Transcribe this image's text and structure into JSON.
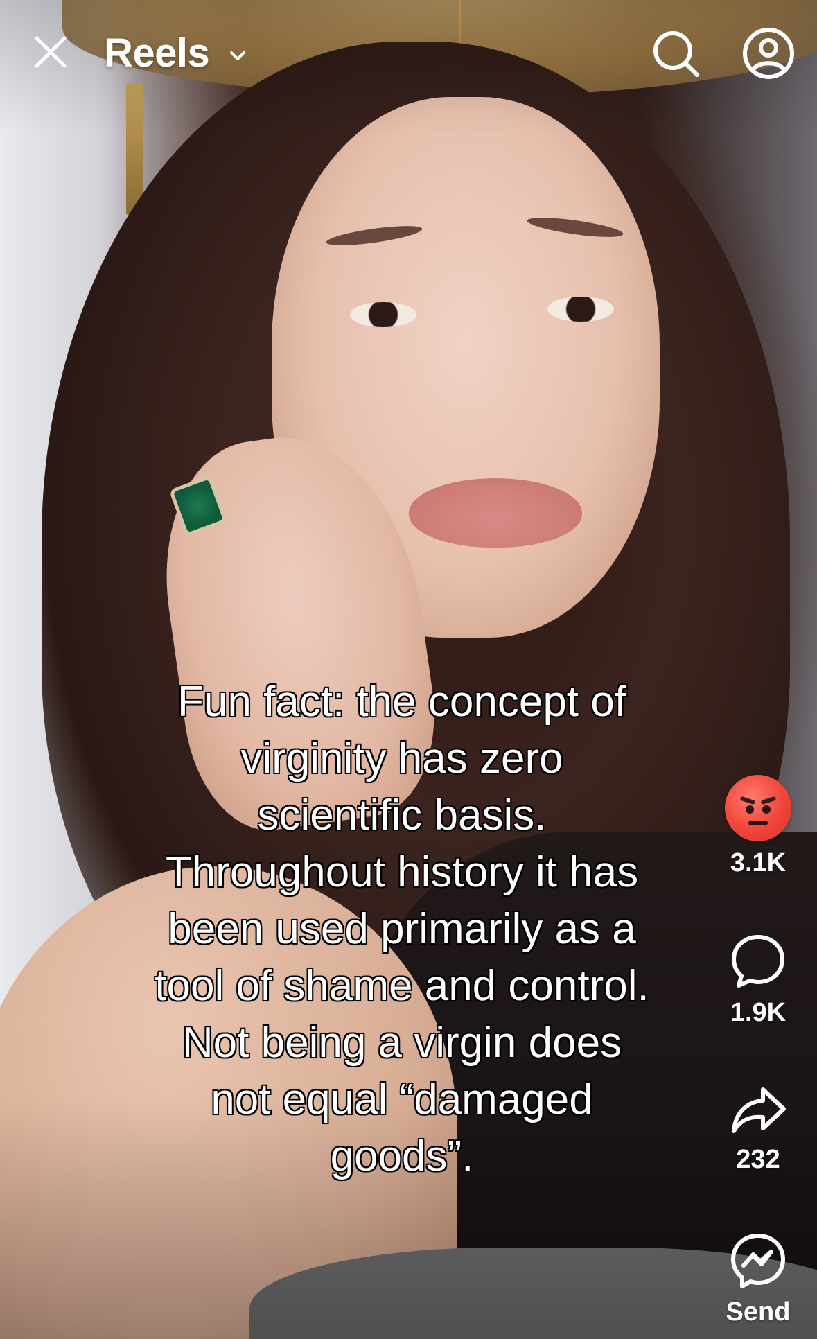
{
  "header": {
    "title": "Reels"
  },
  "caption": {
    "lines": [
      "Fun fact: the concept of",
      "virginity has zero",
      "scientific basis.",
      "Throughout history it has",
      "been used primarily as a",
      "tool of shame and control.",
      "Not being a virgin does",
      "not equal “damaged",
      "goods”."
    ]
  },
  "actions": {
    "reaction": {
      "icon": "angry-emoji-icon",
      "count": "3.1K"
    },
    "comment": {
      "icon": "comment-icon",
      "count": "1.9K"
    },
    "share": {
      "icon": "share-icon",
      "count": "232"
    },
    "send": {
      "icon": "messenger-icon",
      "label": "Send"
    }
  },
  "colors": {
    "icon": "#ffffff",
    "angry_emoji": "#f0453a"
  }
}
